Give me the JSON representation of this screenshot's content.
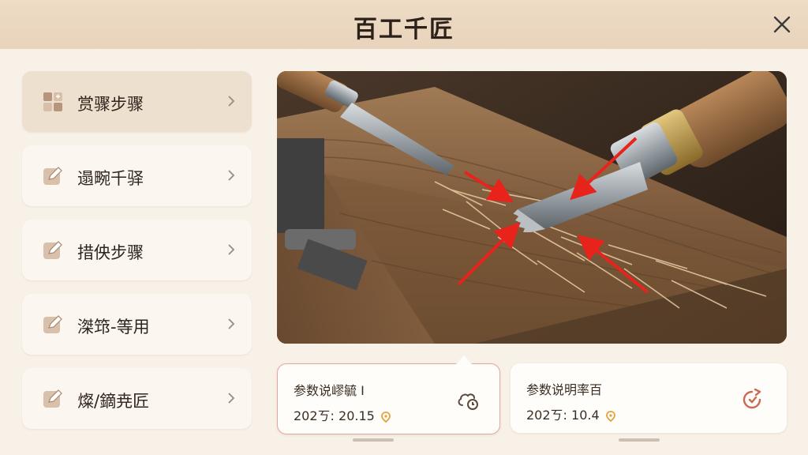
{
  "header": {
    "title": "百工千匠"
  },
  "sidebar": {
    "items": [
      {
        "label": "赏骤步骤",
        "icon": "grid-icon",
        "active": true
      },
      {
        "label": "遢畹千驿",
        "icon": "edit-icon",
        "active": false
      },
      {
        "label": "措佒步骤",
        "icon": "edit-icon",
        "active": false
      },
      {
        "label": "滐筇-等用",
        "icon": "edit-icon",
        "active": false
      },
      {
        "label": "燦/鏑尭匠",
        "icon": "edit-icon",
        "active": false
      }
    ]
  },
  "cards": [
    {
      "title": "参数说嵺毓 I",
      "date": "202ㄎ: 20.15",
      "icon": "cloud-refresh-icon"
    },
    {
      "title": "参数说明率百",
      "date": "202ㄎ: 10.4",
      "icon": "timer-refresh-icon"
    }
  ],
  "colors": {
    "accent": "#c96a52",
    "pin": "#e3a23c",
    "arrow": "#e8231c"
  }
}
